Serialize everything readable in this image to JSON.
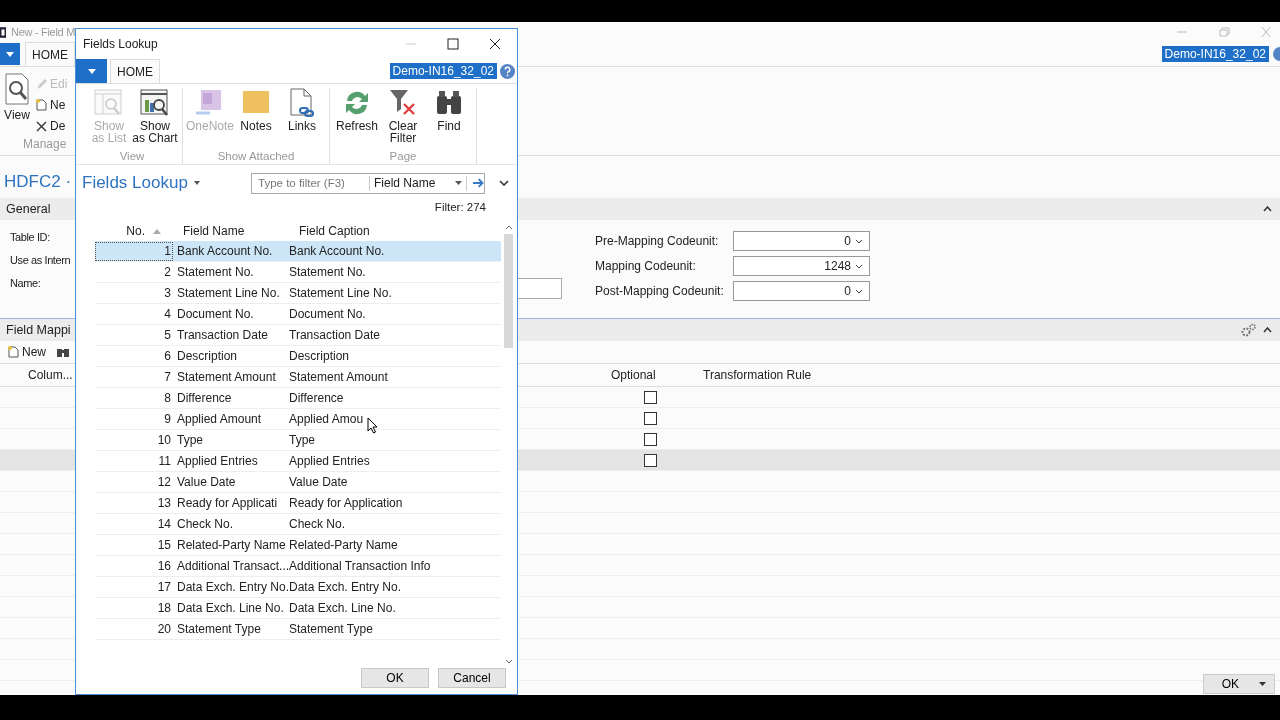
{
  "app": {
    "title": "New - Field M",
    "home_tab": "HOME",
    "company": "Demo-IN16_32_02",
    "ribbon": {
      "items": [
        {
          "label": "View",
          "kind": "large",
          "disabled": false
        },
        {
          "label": "Edi",
          "kind": "edit",
          "disabled": true
        },
        {
          "label": "Ne",
          "kind": "new",
          "disabled": false
        },
        {
          "label": "De",
          "kind": "delete",
          "disabled": false
        }
      ],
      "group": "Manage"
    },
    "page_title": "HDFC2 ·",
    "general": {
      "title": "General",
      "expanded": true,
      "left_fields": [
        "Table ID:",
        "Use as Intern",
        "Name:"
      ],
      "right_fields": [
        {
          "label": "Pre-Mapping Codeunit:",
          "value": "0"
        },
        {
          "label": "Mapping Codeunit:",
          "value": "1248"
        },
        {
          "label": "Post-Mapping Codeunit:",
          "value": "0"
        }
      ]
    },
    "mapping": {
      "title": "Field Mappi",
      "expanded": true,
      "new_action": "New",
      "columns": [
        "Colum...",
        "Optional",
        "Transformation Rule"
      ],
      "rows": [
        {
          "optional": false,
          "selected": false
        },
        {
          "optional": false,
          "selected": false
        },
        {
          "optional": false,
          "selected": false
        },
        {
          "optional": false,
          "selected": true
        }
      ]
    },
    "ok_button": "OK"
  },
  "dialog": {
    "title": "Fields Lookup",
    "home_tab": "HOME",
    "company": "Demo-IN16_32_02",
    "ribbon_groups": [
      {
        "label": "View",
        "buttons": [
          {
            "label": "Show as List",
            "kind": "list",
            "disabled": true
          },
          {
            "label": "Show as Chart",
            "kind": "chart",
            "disabled": false
          }
        ]
      },
      {
        "label": "Show Attached",
        "buttons": [
          {
            "label": "OneNote",
            "kind": "onenote",
            "disabled": true
          },
          {
            "label": "Notes",
            "kind": "notes",
            "disabled": false
          },
          {
            "label": "Links",
            "kind": "links",
            "disabled": false
          }
        ]
      },
      {
        "label": "Page",
        "buttons": [
          {
            "label": "Refresh",
            "kind": "refresh",
            "disabled": false
          },
          {
            "label": "Clear Filter",
            "kind": "clearfilter",
            "disabled": false
          },
          {
            "label": "Find",
            "kind": "find",
            "disabled": false
          }
        ]
      }
    ],
    "page_title": "Fields Lookup",
    "filter_placeholder": "Type to filter (F3)",
    "filter_field": "Field Name",
    "filter_count": "Filter: 274",
    "columns": [
      "No.",
      "Field Name",
      "Field Caption"
    ],
    "rows": [
      {
        "no": "1",
        "name": "Bank Account No.",
        "caption": "Bank Account No.",
        "selected": true
      },
      {
        "no": "2",
        "name": "Statement No.",
        "caption": "Statement No.",
        "selected": false
      },
      {
        "no": "3",
        "name": "Statement Line No.",
        "caption": "Statement Line No.",
        "selected": false
      },
      {
        "no": "4",
        "name": "Document No.",
        "caption": "Document No.",
        "selected": false
      },
      {
        "no": "5",
        "name": "Transaction Date",
        "caption": "Transaction Date",
        "selected": false
      },
      {
        "no": "6",
        "name": "Description",
        "caption": "Description",
        "selected": false
      },
      {
        "no": "7",
        "name": "Statement Amount",
        "caption": "Statement Amount",
        "selected": false
      },
      {
        "no": "8",
        "name": "Difference",
        "caption": "Difference",
        "selected": false
      },
      {
        "no": "9",
        "name": "Applied Amount",
        "caption": "Applied Amou",
        "selected": false
      },
      {
        "no": "10",
        "name": "Type",
        "caption": "Type",
        "selected": false
      },
      {
        "no": "11",
        "name": "Applied Entries",
        "caption": "Applied Entries",
        "selected": false
      },
      {
        "no": "12",
        "name": "Value Date",
        "caption": "Value Date",
        "selected": false
      },
      {
        "no": "13",
        "name": "Ready for Applicati",
        "caption": "Ready for Application",
        "selected": false
      },
      {
        "no": "14",
        "name": "Check No.",
        "caption": "Check No.",
        "selected": false
      },
      {
        "no": "15",
        "name": "Related-Party Name",
        "caption": "Related-Party Name",
        "selected": false
      },
      {
        "no": "16",
        "name": "Additional Transact...",
        "caption": "Additional Transaction Info",
        "selected": false
      },
      {
        "no": "17",
        "name": "Data Exch. Entry No.",
        "caption": "Data Exch. Entry No.",
        "selected": false
      },
      {
        "no": "18",
        "name": "Data Exch. Line No.",
        "caption": "Data Exch. Line No.",
        "selected": false
      },
      {
        "no": "20",
        "name": "Statement Type",
        "caption": "Statement Type",
        "selected": false
      }
    ],
    "buttons": [
      "OK",
      "Cancel"
    ]
  }
}
